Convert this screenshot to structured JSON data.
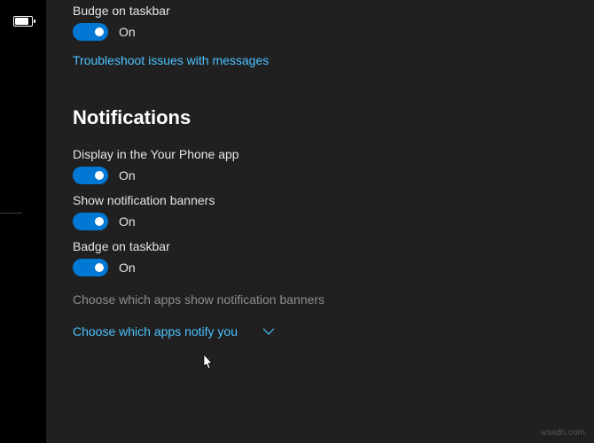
{
  "sidebar": {
    "battery_name": "battery-icon"
  },
  "messages": {
    "badge_label_truncated": "Budge on taskbar",
    "badge_toggle_state": "On",
    "troubleshoot_link": "Troubleshoot issues with messages"
  },
  "notifications": {
    "title": "Notifications",
    "display_label": "Display in the Your Phone app",
    "display_state": "On",
    "banners_label": "Show notification banners",
    "banners_state": "On",
    "badge_label": "Badge on taskbar",
    "badge_state": "On",
    "choose_apps_subtle": "Choose which apps show notification banners",
    "choose_apps_link": "Choose which apps notify you"
  },
  "watermark": "wsxdn.com"
}
